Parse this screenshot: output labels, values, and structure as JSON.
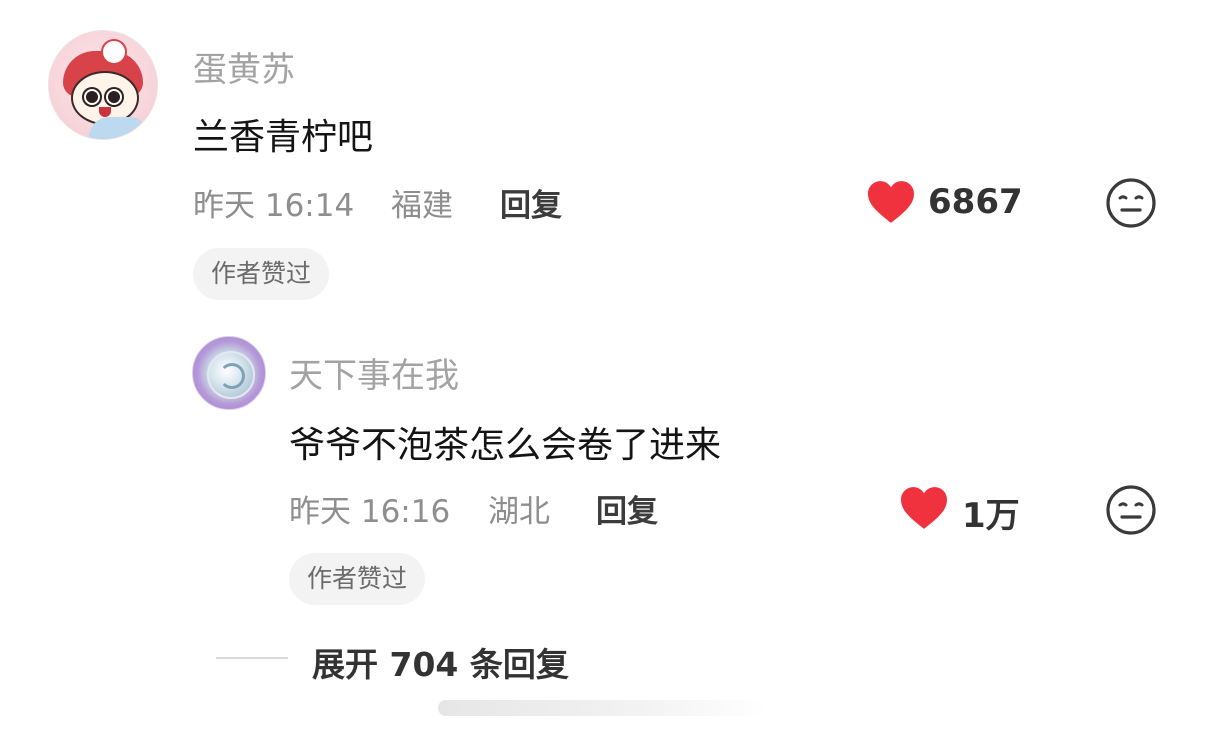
{
  "comment": {
    "username": "蛋黄苏",
    "text": "兰香青柠吧",
    "time": "昨天 16:14",
    "location": "福建",
    "reply_label": "回复",
    "likes": "6867",
    "badge": "作者赞过"
  },
  "reply": {
    "username": "天下事在我",
    "text": "爷爷不泡茶怎么会卷了进来",
    "time": "昨天 16:16",
    "location": "湖北",
    "reply_label": "回复",
    "likes": "1万",
    "badge": "作者赞过"
  },
  "expand": {
    "label": "展开 704 条回复"
  },
  "colors": {
    "heart": "#f0323f",
    "icon_stroke": "#3a3a3a",
    "badge_bg": "#f3f3f3"
  },
  "icons": {
    "like": "heart-icon",
    "dislike": "meh-face-icon"
  }
}
